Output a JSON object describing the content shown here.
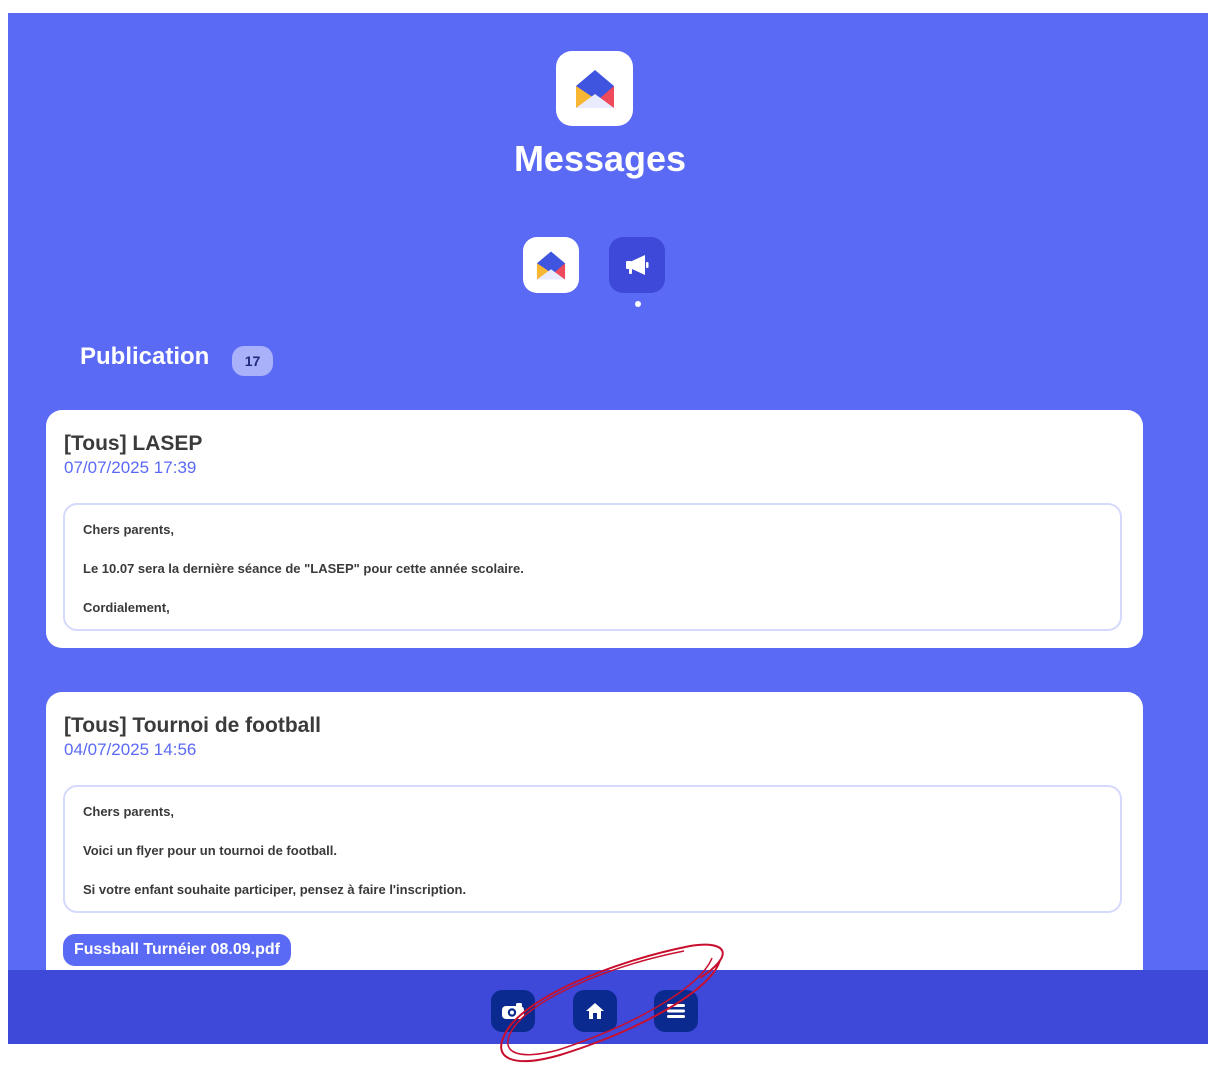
{
  "header": {
    "title": "Messages",
    "app_icon": "envelope-icon"
  },
  "switcher": {
    "items": [
      {
        "icon": "envelope-icon",
        "active": false
      },
      {
        "icon": "megaphone-icon",
        "active": true
      }
    ]
  },
  "section": {
    "title": "Publication",
    "count": "17"
  },
  "posts": [
    {
      "title": "[Tous] LASEP",
      "date": "07/07/2025 17:39",
      "lines": [
        "Chers parents,",
        "Le 10.07 sera la dernière séance de \"LASEP\" pour cette année scolaire.",
        "Cordialement,"
      ]
    },
    {
      "title": "[Tous] Tournoi de football",
      "date": "04/07/2025 14:56",
      "lines": [
        "Chers parents,",
        "Voici un flyer pour un tournoi de football.",
        "Si votre enfant souhaite participer, pensez à faire l'inscription."
      ],
      "attachment": "Fussball Turnéier 08.09.pdf"
    }
  ],
  "bottom_nav": {
    "items": [
      {
        "icon": "camera-icon"
      },
      {
        "icon": "home-icon"
      },
      {
        "icon": "menu-icon"
      }
    ]
  },
  "colors": {
    "background": "#5b6af5",
    "nav_bar": "#3e48d9",
    "nav_button": "#0b2a8f",
    "accent_text": "#5b6af5",
    "annotation": "#c8102e"
  }
}
